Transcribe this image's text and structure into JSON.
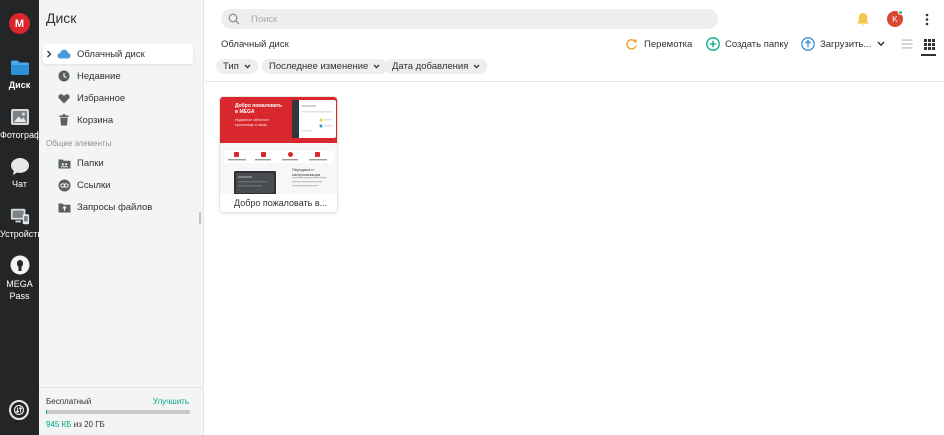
{
  "rail": {
    "logo_letter": "M",
    "items": [
      {
        "label": "Диск",
        "icon": "folder-icon"
      },
      {
        "label": "Фотографии",
        "icon": "photos-icon"
      },
      {
        "label": "Чат",
        "icon": "chat-icon"
      },
      {
        "label": "Устройства",
        "icon": "devices-icon"
      },
      {
        "label_line1": "MEGA",
        "label_line2": "Pass",
        "icon": "mega-pass-icon"
      }
    ]
  },
  "sidebar": {
    "title": "Диск",
    "items": [
      {
        "label": "Облачный диск",
        "icon": "cloud-icon"
      },
      {
        "label": "Недавние",
        "icon": "clock-icon"
      },
      {
        "label": "Избранное",
        "icon": "heart-icon"
      },
      {
        "label": "Корзина",
        "icon": "trash-icon"
      }
    ],
    "section_title": "Общие элементы",
    "shared_items": [
      {
        "label": "Папки",
        "icon": "shared-folders-icon"
      },
      {
        "label": "Ссылки",
        "icon": "link-icon"
      },
      {
        "label": "Запросы файлов",
        "icon": "file-request-icon"
      }
    ],
    "storage": {
      "plan": "Бесплатный",
      "upgrade": "Улучшить",
      "used": "945 КБ",
      "total_text": "из 20 ГБ",
      "used_fraction": 0.001
    }
  },
  "search": {
    "placeholder": "Поиск"
  },
  "header": {
    "avatar_letter": "K"
  },
  "breadcrumb": "Облачный диск",
  "toolbar": {
    "rewind": "Перемотка",
    "create_folder": "Создать папку",
    "upload": "Загрузить..."
  },
  "filters": {
    "type": "Тип",
    "modified": "Последнее изменение",
    "added": "Дата добавления"
  },
  "files": [
    {
      "name": "Добро пожаловать в MEGA.pdf",
      "display_name": "Добро пожаловать в..."
    }
  ],
  "thumbnail": {
    "heading_line1": "Добро пожаловать",
    "heading_line2": "в MEGA",
    "sub_line1": "Надежное облачное",
    "sub_line2": "хранилище и связь",
    "sync_line1": "Передача и",
    "sync_line2": "синхронизация"
  },
  "colors": {
    "rail_bg": "#242526",
    "sidebar_bg": "#f3f4f4",
    "brand_red": "#d9272e",
    "accent_green": "#00a886",
    "bell_yellow": "#f5c64c"
  }
}
